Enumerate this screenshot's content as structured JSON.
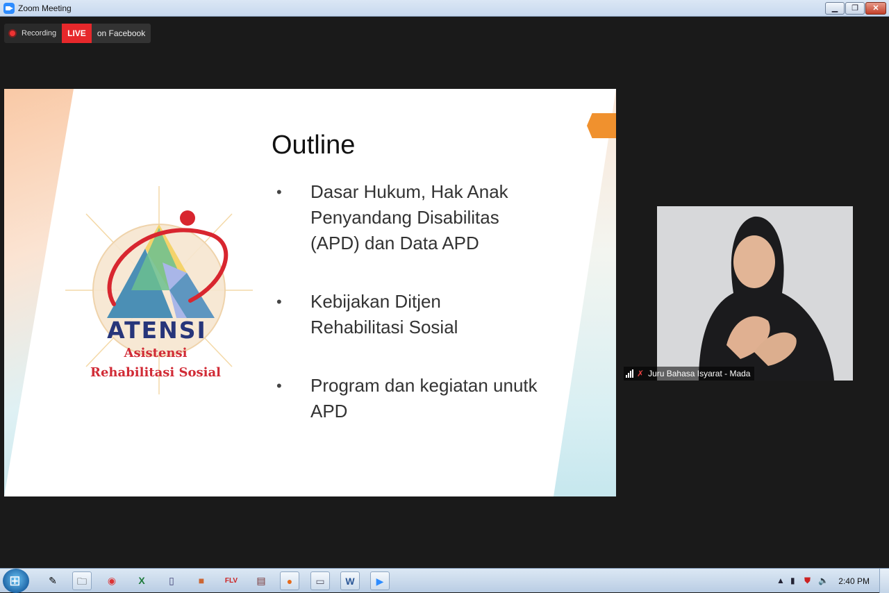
{
  "window": {
    "title": "Zoom Meeting",
    "controls": {
      "minimize": "▁",
      "maximize": "❐",
      "close": "✕"
    }
  },
  "recording": {
    "status_label": "Recording",
    "live_badge": "LIVE",
    "live_target": "on Facebook"
  },
  "slide": {
    "logo": {
      "word": "ATENSI",
      "line1": "Asistensi",
      "line2": "Rehabilitasi Sosial"
    },
    "title": "Outline",
    "bullet_mark": "•",
    "bullets": [
      {
        "line1": "Dasar Hukum, Hak Anak",
        "line2": "Penyandang Disabilitas",
        "line3": "(APD) dan Data APD"
      },
      {
        "line1": "Kebijakan Ditjen",
        "line2": "Rehabilitasi Sosial"
      },
      {
        "line1": "Program dan kegiatan unutk",
        "line2": "APD"
      }
    ]
  },
  "participant": {
    "name": "Juru Bahasa Isyarat - Mada",
    "mic_muted": true
  },
  "taskbar": {
    "icons": [
      "notepad-icon",
      "explorer-icon",
      "chrome-icon",
      "excel-icon",
      "phone-icon",
      "app-icon",
      "flv-icon",
      "winrar-icon",
      "firefox-icon",
      "scanner-icon",
      "word-icon",
      "zoom-icon"
    ],
    "clock": "2:40 PM"
  },
  "colors": {
    "live_red": "#e6282b",
    "zoom_blue": "#2d8cff",
    "logo_navy": "#27357a",
    "logo_red": "#d12b36",
    "accent_orange": "#f0912e"
  }
}
